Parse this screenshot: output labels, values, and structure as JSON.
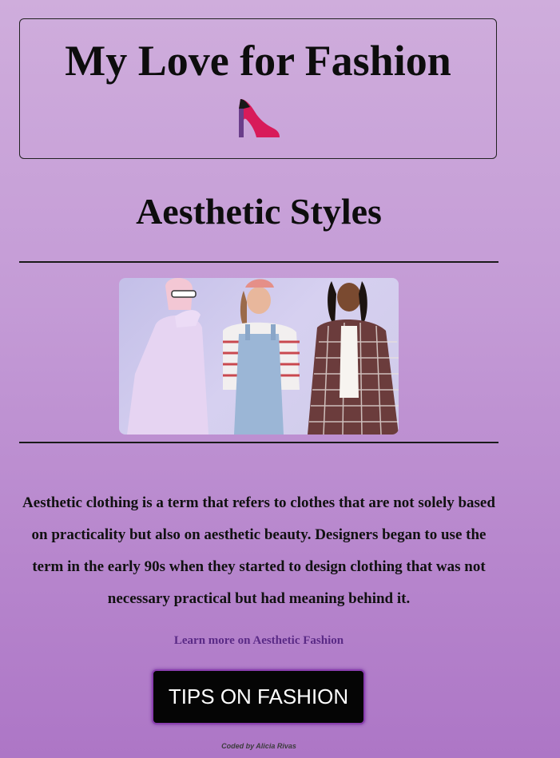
{
  "header": {
    "title": "My Love for Fashion",
    "icon": "high-heel-icon"
  },
  "main": {
    "section_title": "Aesthetic Styles",
    "hero_image": "three-models-aesthetic-outfits",
    "description": "Aesthetic clothing is a term that refers to clothes that are not solely based on practicality but also on aesthetic beauty. Designers began to use the term in the early 90s when they started to design clothing that was not necessary practical but had meaning behind it.",
    "learn_more_link": "Learn more on Aesthetic Fashion",
    "tips_button": "TIPS ON FASHION"
  },
  "footer": {
    "credit": "Coded by Alicia Rivas"
  },
  "colors": {
    "background_top": "#cfaddc",
    "background_bottom": "#ad76c6",
    "heel": "#d81b5a",
    "button_bg": "#050505",
    "link": "#5a2a86"
  }
}
